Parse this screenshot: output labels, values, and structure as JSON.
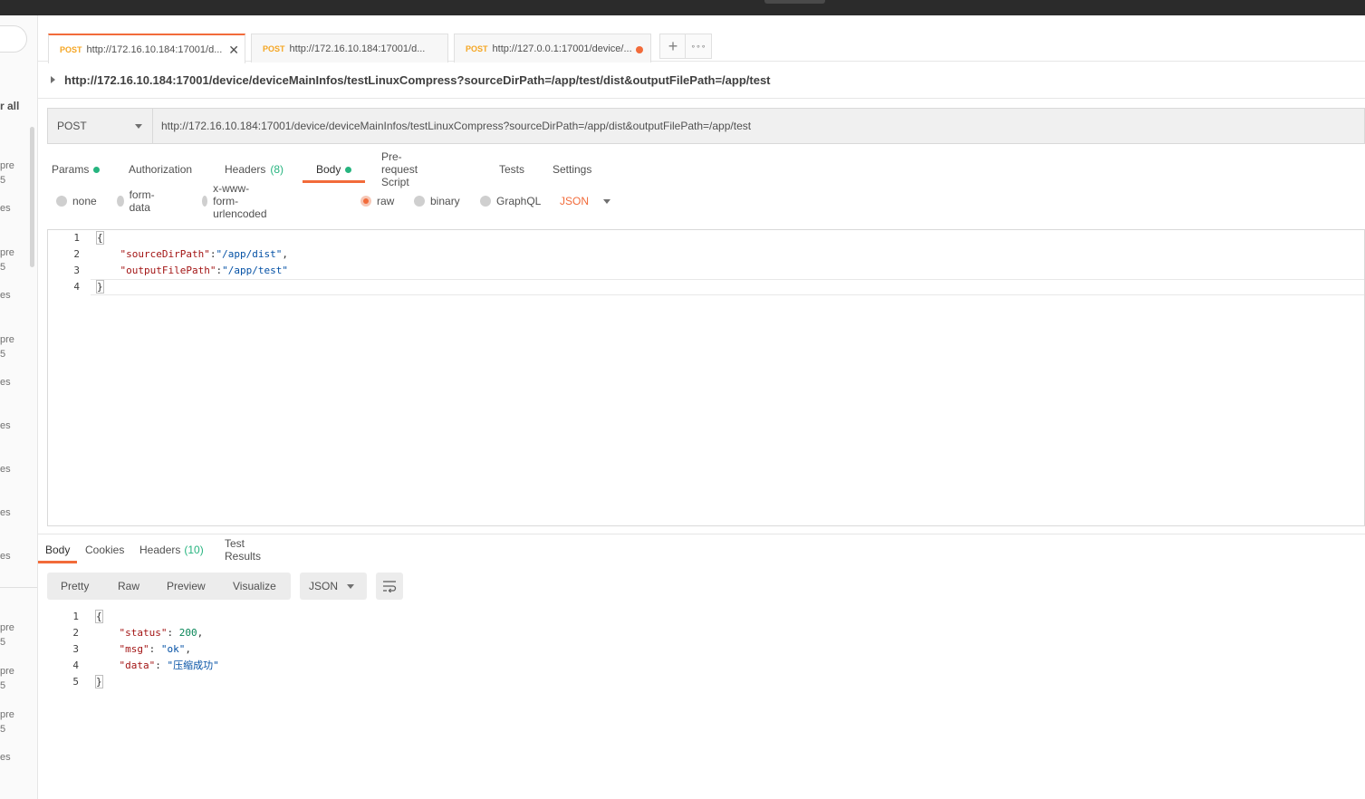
{
  "sidebar": {
    "view_all": "r all",
    "fragments": [
      {
        "text": "pre"
      },
      {
        "text": "5"
      },
      {
        "text": "es"
      },
      {
        "text": "pre"
      },
      {
        "text": "5"
      },
      {
        "text": "es"
      },
      {
        "text": "pre"
      },
      {
        "text": "5"
      },
      {
        "text": "es"
      },
      {
        "text": "es"
      },
      {
        "text": "es"
      },
      {
        "text": "es"
      },
      {
        "text": "es"
      },
      {
        "text": "pre"
      },
      {
        "text": "5"
      },
      {
        "text": "pre"
      },
      {
        "text": "5"
      },
      {
        "text": "pre"
      },
      {
        "text": "5"
      },
      {
        "text": "es"
      }
    ]
  },
  "tabs": [
    {
      "method": "POST",
      "label": "http://172.16.10.184:17001/d...",
      "state": "active",
      "close": "✕"
    },
    {
      "method": "POST",
      "label": "http://172.16.10.184:17001/d...",
      "state": "inactive"
    },
    {
      "method": "POST",
      "label": "http://127.0.0.1:17001/device/...",
      "state": "unsaved"
    }
  ],
  "tab_actions": {
    "new_tab": "+",
    "more": "∘∘∘"
  },
  "breadcrumb": {
    "url": "http://172.16.10.184:17001/device/deviceMainInfos/testLinuxCompress?sourceDirPath=/app/test/dist&outputFilePath=/app/test"
  },
  "request": {
    "method": "POST",
    "url": "http://172.16.10.184:17001/device/deviceMainInfos/testLinuxCompress?sourceDirPath=/app/dist&outputFilePath=/app/test"
  },
  "request_tabs": {
    "params": "Params",
    "authorization": "Authorization",
    "headers": "Headers",
    "headers_count": "(8)",
    "body": "Body",
    "prerequest": "Pre-request Script",
    "tests": "Tests",
    "settings": "Settings"
  },
  "body_types": {
    "none": "none",
    "form_data": "form-data",
    "urlencoded": "x-www-form-urlencoded",
    "raw": "raw",
    "binary": "binary",
    "graphql": "GraphQL",
    "format": "JSON",
    "selected": "raw"
  },
  "request_body": {
    "line_numbers": [
      "1",
      "2",
      "3",
      "4"
    ],
    "open": "{",
    "k1": "\"sourceDirPath\"",
    "v1": "\"/app/dist\"",
    "k2": "\"outputFilePath\"",
    "v2": "\"/app/test\"",
    "close": "}"
  },
  "response_tabs": {
    "body": "Body",
    "cookies": "Cookies",
    "headers": "Headers",
    "headers_count": "(10)",
    "test_results": "Test Results"
  },
  "response_view": {
    "pretty": "Pretty",
    "raw": "Raw",
    "preview": "Preview",
    "visualize": "Visualize",
    "format": "JSON"
  },
  "response_body": {
    "line_numbers": [
      "1",
      "2",
      "3",
      "4",
      "5"
    ],
    "open": "{",
    "k1": "\"status\"",
    "v1": "200",
    "k2": "\"msg\"",
    "v2": "\"ok\"",
    "k3": "\"data\"",
    "v3": "\"压缩成功\"",
    "close": "}"
  },
  "colors": {
    "accent": "#f26b3a",
    "method_post": "#f5a623",
    "success": "#26b47f",
    "json_key": "#a31515",
    "json_string": "#0451a5",
    "json_number": "#098658"
  }
}
